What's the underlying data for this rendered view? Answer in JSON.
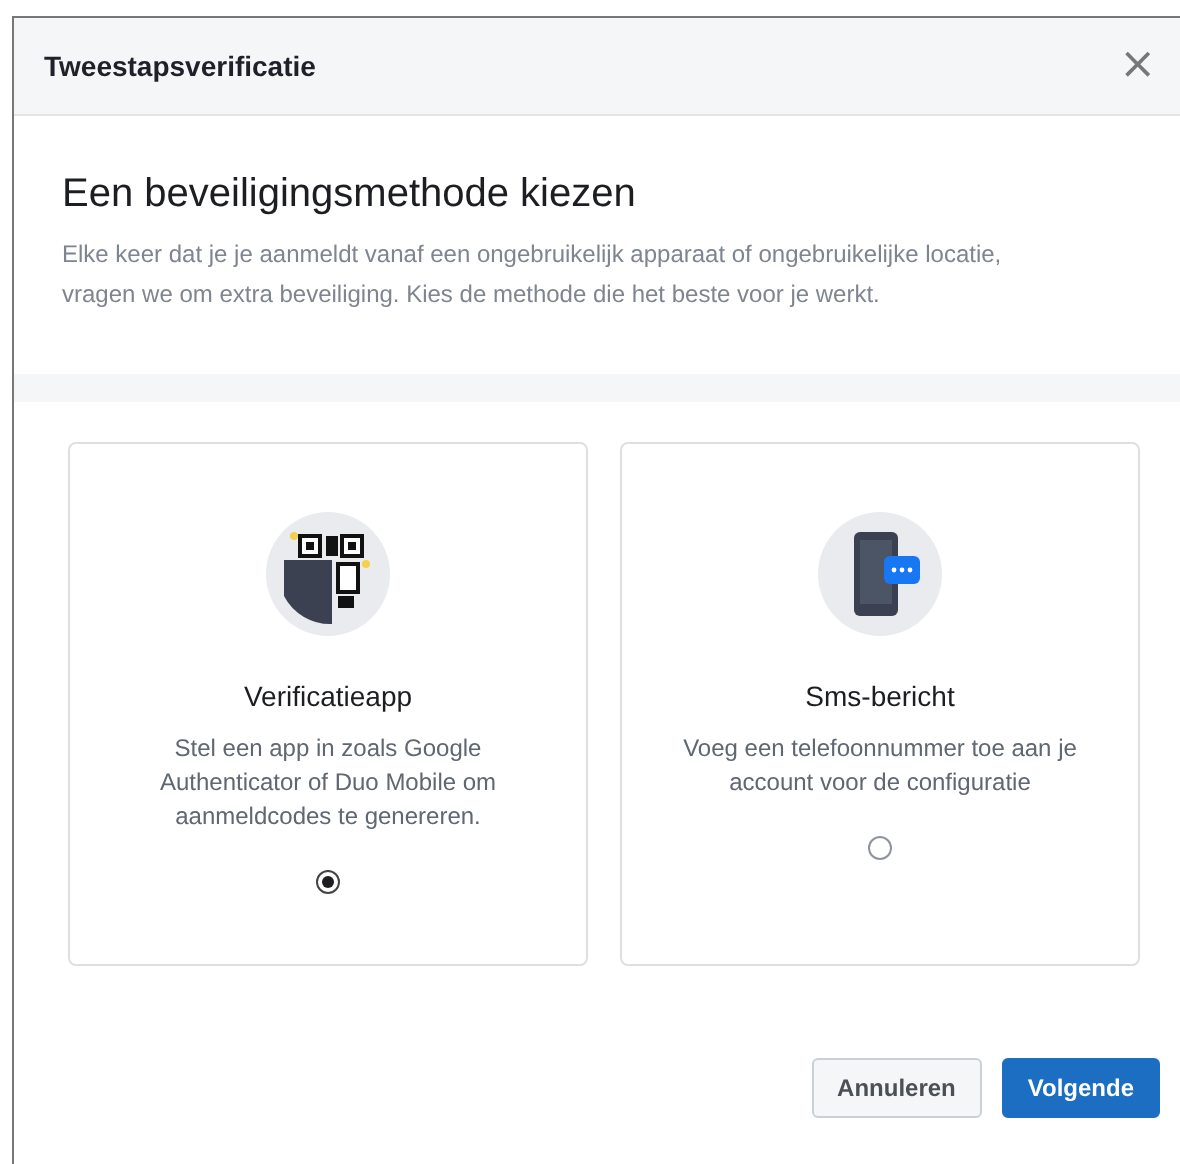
{
  "dialog": {
    "title": "Tweestapsverificatie",
    "close": "×"
  },
  "heading": "Een beveiligingsmethode kiezen",
  "intro": "Elke keer dat je je aanmeldt vanaf een ongebruikelijk apparaat of ongebruikelijke locatie, vragen we om extra beveiliging. Kies de methode die het beste voor je werkt.",
  "methods": [
    {
      "kind": "app",
      "title": "Verificatieapp",
      "description": "Stel een app in zoals Google Authenticator of Duo Mobile om aanmeldcodes te genereren.",
      "selected": true
    },
    {
      "kind": "sms",
      "title": "Sms-bericht",
      "description": "Voeg een telefoonnummer toe aan je account voor de configuratie",
      "selected": false
    }
  ],
  "buttons": [
    {
      "kind": "secondary",
      "label": "Annuleren"
    },
    {
      "kind": "primary",
      "label": "Volgende"
    }
  ]
}
